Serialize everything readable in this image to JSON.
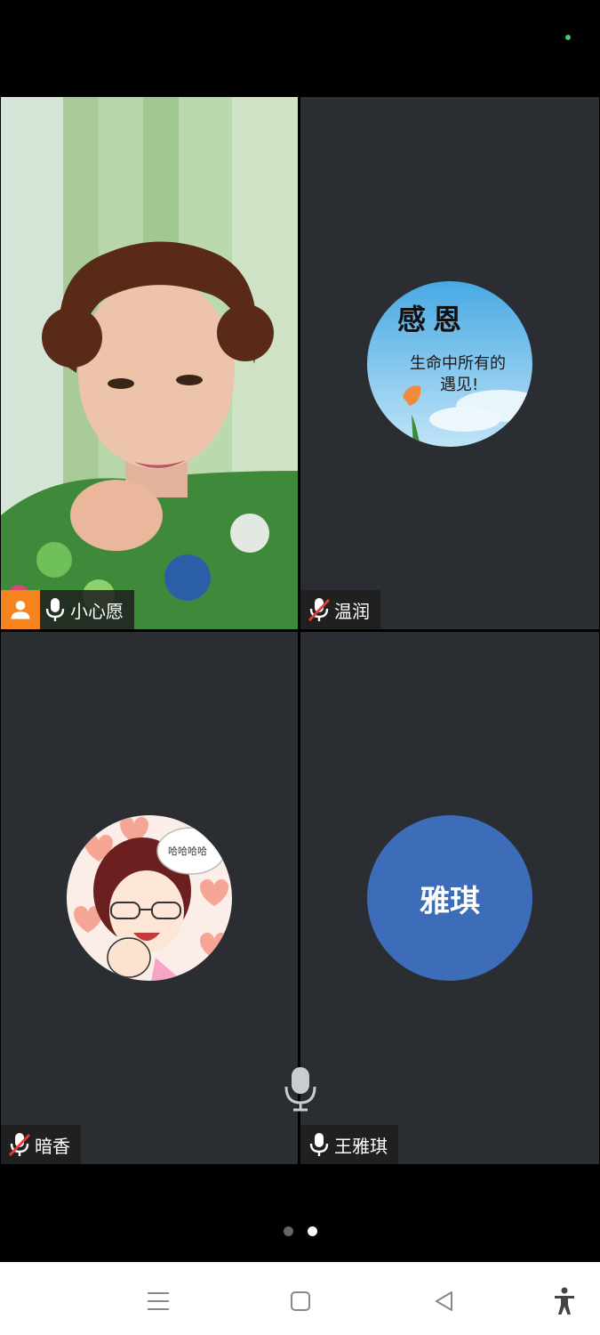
{
  "status_bar": {
    "indicator_color": "#3ecf6a"
  },
  "participants": [
    {
      "name": "小心愿",
      "mic": "on",
      "is_host": true,
      "video": "camera"
    },
    {
      "name": "温润",
      "mic": "muted",
      "avatar_text_title": "感恩",
      "avatar_text_line1": "生命中所有的",
      "avatar_text_line2": "遇见!"
    },
    {
      "name": "暗香",
      "mic": "muted",
      "avatar_bubble": "哈哈哈哈"
    },
    {
      "name": "王雅琪",
      "mic": "on",
      "avatar_initials": "雅琪",
      "avatar_color": "#3d6cb9"
    }
  ],
  "pager": {
    "pages": 2,
    "active_index": 1
  },
  "navbar": {
    "buttons": [
      "menu-icon",
      "home-square-icon",
      "back-triangle-icon",
      "accessibility-icon"
    ]
  }
}
